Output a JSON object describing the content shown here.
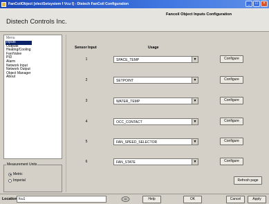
{
  "window": {
    "title": "FanCoilObject [electSetsystem f Vcu I] - Distech FanCoil Configuration",
    "min_glyph": "_",
    "max_glyph": "□",
    "close_glyph": "×"
  },
  "header": {
    "company": "Distech Controls Inc.",
    "section_title": "Fancoil Object Inputs Configuration"
  },
  "menu": {
    "caption": "Menu",
    "items": [
      {
        "label": "Inputs",
        "active": true
      },
      {
        "label": "Outputs"
      },
      {
        "label": "Heating/Cooling"
      },
      {
        "label": "Fan/Valve"
      },
      {
        "label": "PID"
      },
      {
        "label": "Alarm"
      },
      {
        "label": "Network Input"
      },
      {
        "label": "Network Output"
      },
      {
        "label": "Object Manager"
      },
      {
        "label": "About"
      }
    ]
  },
  "units": {
    "caption": "Measurement Units",
    "options": [
      {
        "label": "Metric",
        "checked": true
      },
      {
        "label": "Imperial",
        "checked": false
      }
    ]
  },
  "table": {
    "col_sensor": "Sensor Input",
    "col_usage": "Usage",
    "rows": [
      {
        "num": "1",
        "usage": "SPACE_TEMP",
        "configure": "Configure"
      },
      {
        "num": "2",
        "usage": "SETPOINT",
        "configure": "Configure"
      },
      {
        "num": "3",
        "usage": "WATER_TEMP",
        "configure": "Configure"
      },
      {
        "num": "4",
        "usage": "OCC_CONTACT",
        "configure": "Configure"
      },
      {
        "num": "5",
        "usage": "FAN_SPEED_SELECTOR",
        "configure": "Configure"
      },
      {
        "num": "6",
        "usage": "FAN_STATE",
        "configure": "Configure"
      }
    ],
    "dropdown_glyph": "▼"
  },
  "refresh_label": "Refresh page",
  "bottom": {
    "location_label": "Location",
    "location_value": "fcu1",
    "help": "Help",
    "ok": "OK",
    "cancel": "Cancel",
    "apply": "Apply"
  }
}
